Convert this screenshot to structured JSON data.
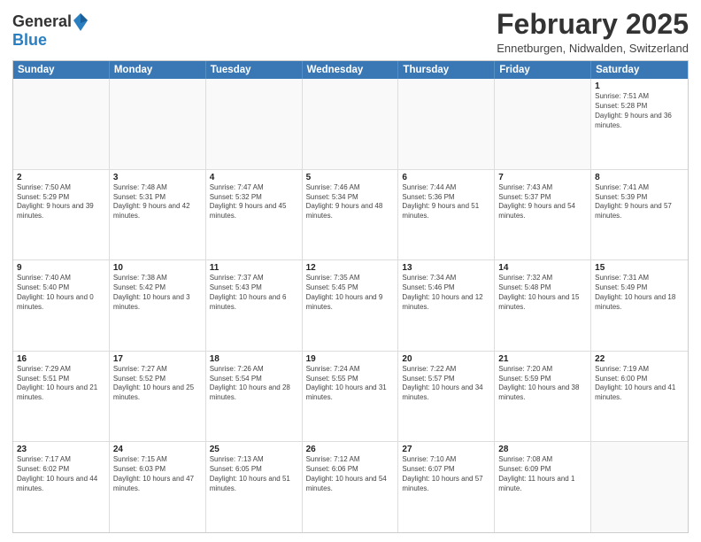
{
  "header": {
    "logo_general": "General",
    "logo_blue": "Blue",
    "month_title": "February 2025",
    "location": "Ennetburgen, Nidwalden, Switzerland"
  },
  "weekdays": [
    "Sunday",
    "Monday",
    "Tuesday",
    "Wednesday",
    "Thursday",
    "Friday",
    "Saturday"
  ],
  "rows": [
    [
      {
        "day": "",
        "info": ""
      },
      {
        "day": "",
        "info": ""
      },
      {
        "day": "",
        "info": ""
      },
      {
        "day": "",
        "info": ""
      },
      {
        "day": "",
        "info": ""
      },
      {
        "day": "",
        "info": ""
      },
      {
        "day": "1",
        "info": "Sunrise: 7:51 AM\nSunset: 5:28 PM\nDaylight: 9 hours and 36 minutes."
      }
    ],
    [
      {
        "day": "2",
        "info": "Sunrise: 7:50 AM\nSunset: 5:29 PM\nDaylight: 9 hours and 39 minutes."
      },
      {
        "day": "3",
        "info": "Sunrise: 7:48 AM\nSunset: 5:31 PM\nDaylight: 9 hours and 42 minutes."
      },
      {
        "day": "4",
        "info": "Sunrise: 7:47 AM\nSunset: 5:32 PM\nDaylight: 9 hours and 45 minutes."
      },
      {
        "day": "5",
        "info": "Sunrise: 7:46 AM\nSunset: 5:34 PM\nDaylight: 9 hours and 48 minutes."
      },
      {
        "day": "6",
        "info": "Sunrise: 7:44 AM\nSunset: 5:36 PM\nDaylight: 9 hours and 51 minutes."
      },
      {
        "day": "7",
        "info": "Sunrise: 7:43 AM\nSunset: 5:37 PM\nDaylight: 9 hours and 54 minutes."
      },
      {
        "day": "8",
        "info": "Sunrise: 7:41 AM\nSunset: 5:39 PM\nDaylight: 9 hours and 57 minutes."
      }
    ],
    [
      {
        "day": "9",
        "info": "Sunrise: 7:40 AM\nSunset: 5:40 PM\nDaylight: 10 hours and 0 minutes."
      },
      {
        "day": "10",
        "info": "Sunrise: 7:38 AM\nSunset: 5:42 PM\nDaylight: 10 hours and 3 minutes."
      },
      {
        "day": "11",
        "info": "Sunrise: 7:37 AM\nSunset: 5:43 PM\nDaylight: 10 hours and 6 minutes."
      },
      {
        "day": "12",
        "info": "Sunrise: 7:35 AM\nSunset: 5:45 PM\nDaylight: 10 hours and 9 minutes."
      },
      {
        "day": "13",
        "info": "Sunrise: 7:34 AM\nSunset: 5:46 PM\nDaylight: 10 hours and 12 minutes."
      },
      {
        "day": "14",
        "info": "Sunrise: 7:32 AM\nSunset: 5:48 PM\nDaylight: 10 hours and 15 minutes."
      },
      {
        "day": "15",
        "info": "Sunrise: 7:31 AM\nSunset: 5:49 PM\nDaylight: 10 hours and 18 minutes."
      }
    ],
    [
      {
        "day": "16",
        "info": "Sunrise: 7:29 AM\nSunset: 5:51 PM\nDaylight: 10 hours and 21 minutes."
      },
      {
        "day": "17",
        "info": "Sunrise: 7:27 AM\nSunset: 5:52 PM\nDaylight: 10 hours and 25 minutes."
      },
      {
        "day": "18",
        "info": "Sunrise: 7:26 AM\nSunset: 5:54 PM\nDaylight: 10 hours and 28 minutes."
      },
      {
        "day": "19",
        "info": "Sunrise: 7:24 AM\nSunset: 5:55 PM\nDaylight: 10 hours and 31 minutes."
      },
      {
        "day": "20",
        "info": "Sunrise: 7:22 AM\nSunset: 5:57 PM\nDaylight: 10 hours and 34 minutes."
      },
      {
        "day": "21",
        "info": "Sunrise: 7:20 AM\nSunset: 5:59 PM\nDaylight: 10 hours and 38 minutes."
      },
      {
        "day": "22",
        "info": "Sunrise: 7:19 AM\nSunset: 6:00 PM\nDaylight: 10 hours and 41 minutes."
      }
    ],
    [
      {
        "day": "23",
        "info": "Sunrise: 7:17 AM\nSunset: 6:02 PM\nDaylight: 10 hours and 44 minutes."
      },
      {
        "day": "24",
        "info": "Sunrise: 7:15 AM\nSunset: 6:03 PM\nDaylight: 10 hours and 47 minutes."
      },
      {
        "day": "25",
        "info": "Sunrise: 7:13 AM\nSunset: 6:05 PM\nDaylight: 10 hours and 51 minutes."
      },
      {
        "day": "26",
        "info": "Sunrise: 7:12 AM\nSunset: 6:06 PM\nDaylight: 10 hours and 54 minutes."
      },
      {
        "day": "27",
        "info": "Sunrise: 7:10 AM\nSunset: 6:07 PM\nDaylight: 10 hours and 57 minutes."
      },
      {
        "day": "28",
        "info": "Sunrise: 7:08 AM\nSunset: 6:09 PM\nDaylight: 11 hours and 1 minute."
      },
      {
        "day": "",
        "info": ""
      }
    ]
  ]
}
